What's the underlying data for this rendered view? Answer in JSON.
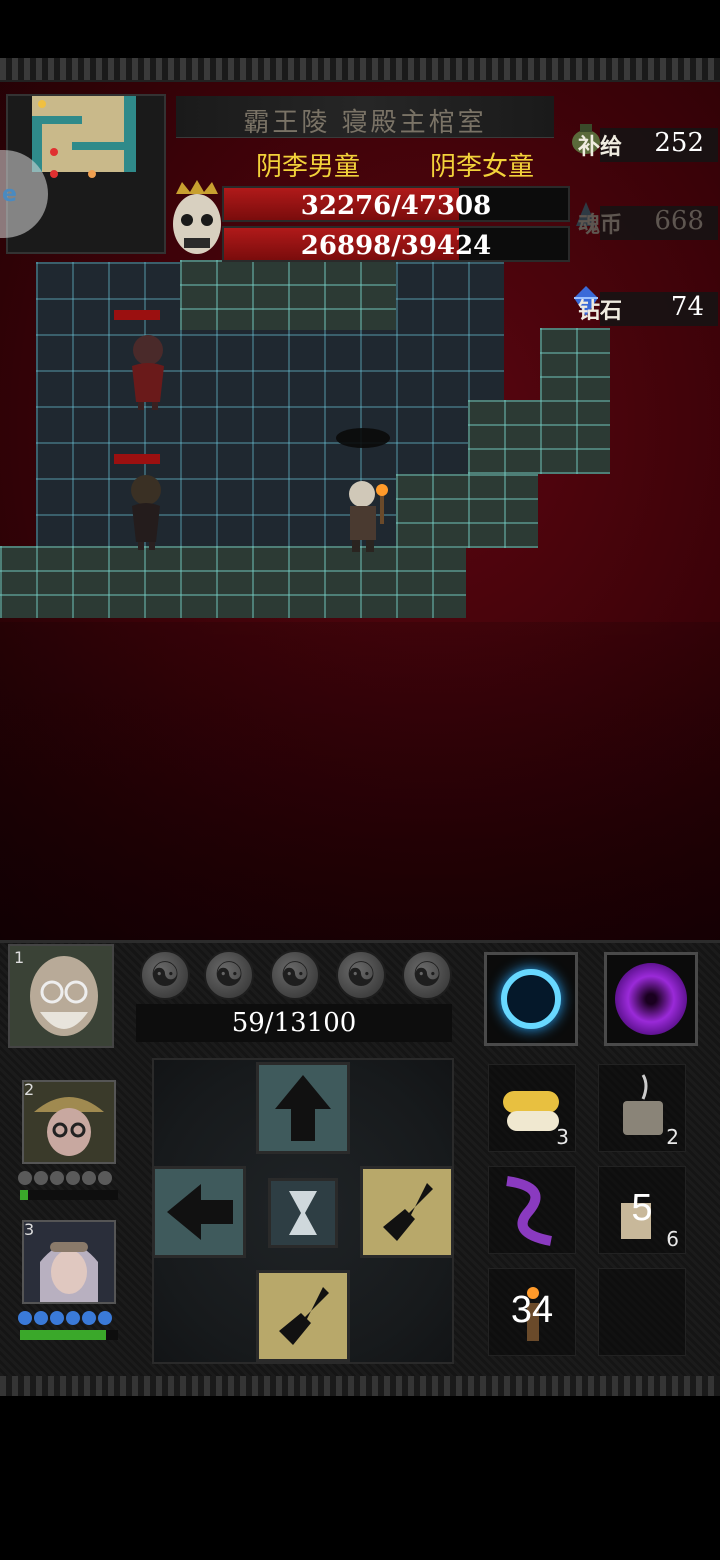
{
  "location_title": "霸王陵 寝殿主棺室",
  "bosses": [
    {
      "name": "阴李男童",
      "hp": "32276/47308",
      "hp_fraction": 0.682
    },
    {
      "name": "阴李女童",
      "hp": "26898/39424",
      "hp_fraction": 0.682
    }
  ],
  "resources": {
    "supply": {
      "label": "补给",
      "value": "252"
    },
    "soul_coin": {
      "label": "魂币",
      "value": "668"
    },
    "diamond": {
      "label": "钻石",
      "value": "74"
    }
  },
  "side_handle_text": "e",
  "leader": {
    "slot": "1",
    "xp": "59/13100"
  },
  "party": [
    {
      "slot": "2",
      "orb_color": "gray",
      "bar_fraction": 0.08
    },
    {
      "slot": "3",
      "orb_color": "blue",
      "bar_fraction": 0.88
    }
  ],
  "orb_glyph": "☯",
  "skills": [
    "lightning-ring-skill",
    "void-vortex-skill"
  ],
  "items": [
    {
      "name": "pill-capsules",
      "count": "3"
    },
    {
      "name": "incense-pot",
      "count": "2"
    },
    {
      "name": "purple-tentacle",
      "count": ""
    },
    {
      "name": "paper-talisman",
      "overlay": "5",
      "count": "6"
    },
    {
      "name": "candle",
      "overlay": "34",
      "count": ""
    },
    {
      "name": "empty-slot",
      "count": ""
    }
  ],
  "colors": {
    "blood_red": "#5a0610",
    "hp_red": "#b01a1a",
    "boss_name_yellow": "#f2d23a",
    "stone_teal": "#6ec8dc"
  }
}
